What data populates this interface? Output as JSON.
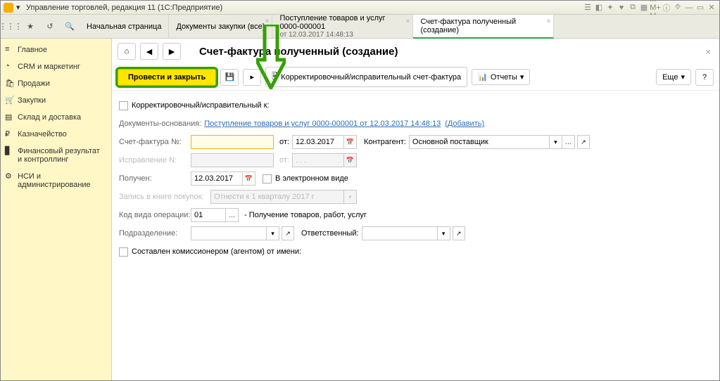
{
  "titlebar": {
    "app_title": "Управление торговлей, редакция 11  (1С:Предприятие)",
    "win_buttons": "M  M+  M-"
  },
  "tabbar": {
    "home": "Начальная страница",
    "t2": "Документы закупки (все)",
    "t3_l1": "Поступление товаров и услуг 0000-000001",
    "t3_l2": "от 12.03.2017 14:48:13",
    "t4": "Счет-фактура полученный (создание)"
  },
  "sidebar": {
    "items": [
      {
        "label": "Главное"
      },
      {
        "label": "CRM и маркетинг"
      },
      {
        "label": "Продажи"
      },
      {
        "label": "Закупки"
      },
      {
        "label": "Склад и доставка"
      },
      {
        "label": "Казначейство"
      },
      {
        "label": "Финансовый результат и контроллинг"
      },
      {
        "label": "НСИ и администрирование"
      }
    ]
  },
  "page": {
    "title": "Счет-фактура полученный (создание)"
  },
  "toolbar": {
    "post_close": "Провести и закрыть",
    "corr": "Корректировочный/исправительный счет-фактура",
    "reports": "Отчеты",
    "more": "Еще",
    "help": "?"
  },
  "form": {
    "chk_corr": "Корректировочный/исправительный к:",
    "basis_lbl": "Документы-основания:",
    "basis_link": "Поступление товаров и услуг 0000-000001 от 12.03.2017 14:48:13",
    "add_link": "(Добавить)",
    "sf_no_lbl": "Счет-фактура №:",
    "sf_no_val": "",
    "ot_lbl": "от:",
    "sf_date": "12.03.2017",
    "kontragent_lbl": "Контрагент:",
    "kontragent_val": "Основной поставщик",
    "isprav_lbl": "Исправление N:",
    "isprav_val": "",
    "isprav_date": ". . .",
    "received_lbl": "Получен:",
    "received_date": "12.03.2017",
    "electronic": "В электронном виде",
    "book_lbl": "Запись в книге покупок:",
    "book_val": "Отнести к 1 кварталу 2017 г",
    "opcode_lbl": "Код вида операции:",
    "opcode_val": "01",
    "opcode_desc": "- Получение товаров, работ, услуг",
    "division_lbl": "Подразделение:",
    "responsible_lbl": "Ответственный:",
    "chk_commiss": "Составлен комиссионером (агентом) от имени:"
  }
}
